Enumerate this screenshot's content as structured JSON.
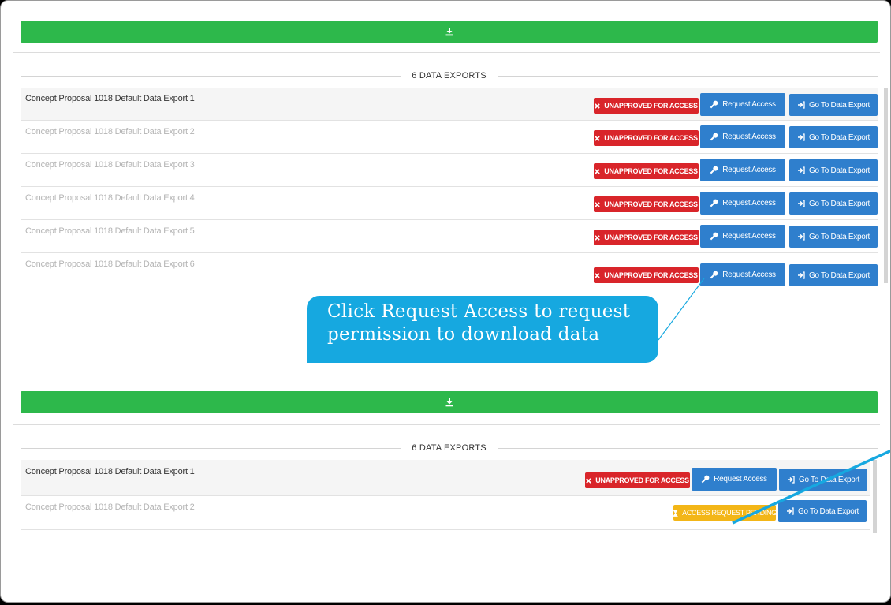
{
  "top_panel": {
    "download_icon": "download-icon",
    "section_title": "6 DATA EXPORTS",
    "rows": [
      {
        "name": "Concept Proposal 1018 Default Data Export 1",
        "status": "UNAPPROVED FOR ACCESS",
        "request": "Request Access",
        "goto": "Go To Data Export"
      },
      {
        "name": "Concept Proposal 1018 Default Data Export 2",
        "status": "UNAPPROVED FOR ACCESS",
        "request": "Request Access",
        "goto": "Go To Data Export"
      },
      {
        "name": "Concept Proposal 1018 Default Data Export 3",
        "status": "UNAPPROVED FOR ACCESS",
        "request": "Request Access",
        "goto": "Go To Data Export"
      },
      {
        "name": "Concept Proposal 1018 Default Data Export 4",
        "status": "UNAPPROVED FOR ACCESS",
        "request": "Request Access",
        "goto": "Go To Data Export"
      },
      {
        "name": "Concept Proposal 1018 Default Data Export 5",
        "status": "UNAPPROVED FOR ACCESS",
        "request": "Request Access",
        "goto": "Go To Data Export"
      },
      {
        "name": "Concept Proposal 1018 Default Data Export 6",
        "status": "UNAPPROVED FOR ACCESS",
        "request": "Request Access",
        "goto": "Go To Data Export"
      }
    ]
  },
  "callout": {
    "line1": "Click Request Access to request",
    "line2": "permission to download data"
  },
  "bottom_panel": {
    "download_icon": "download-icon",
    "section_title": "6 DATA EXPORTS",
    "rows": [
      {
        "name": "Concept Proposal 1018 Default Data Export 1",
        "status": "UNAPPROVED FOR ACCESS",
        "request": "Request Access",
        "goto": "Go To Data Export"
      },
      {
        "name": "Concept Proposal 1018 Default Data Export 2",
        "status": "ACCESS REQUEST PENDING",
        "goto": "Go To Data Export"
      }
    ]
  },
  "colors": {
    "green": "#2db84b",
    "unapproved_red": "#d9252a",
    "button_blue": "#2f7fcd",
    "pending_yellow": "#f3b617",
    "callout_blue": "#16a8e0"
  }
}
